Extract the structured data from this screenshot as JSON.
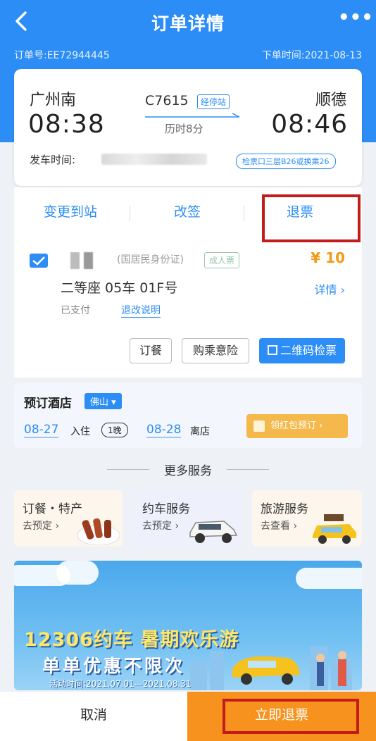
{
  "header": {
    "title": "订单详情",
    "back_icon": "back-arrow-icon",
    "more_icon": "more-dots-icon",
    "more_label": "•••"
  },
  "order": {
    "number": "订单号:EE72944445",
    "placed_time": "下单时间:2021-08-13"
  },
  "trip": {
    "from_station": "广州南",
    "to_station": "顺德",
    "depart_time": "08:38",
    "arrive_time": "08:46",
    "train_no": "C7615",
    "stop_tag": "经停站",
    "duration": "历时8分",
    "depart_label": "发车时间:",
    "gate_info": "检票口三层B26或换乘26"
  },
  "actions": {
    "change_station": "变更到站",
    "reschedule": "改签",
    "refund": "退票"
  },
  "passenger": {
    "id_type": "(国居民身份证)",
    "ticket_type": "成人票",
    "price": "¥ 10",
    "seat": "二等座 05车 01F号",
    "detail": "详情 ›",
    "status": "已支付",
    "rule_link": "退改说明",
    "btn_meal": "订餐",
    "btn_insurance": "购乘意险",
    "btn_qr": "二维码检票"
  },
  "hotel": {
    "title": "预订酒店",
    "city": "佛山 ▾",
    "checkin_date": "08-27",
    "checkin_label": "入住",
    "nights": "1晚",
    "checkout_date": "08-28",
    "checkout_label": "离店",
    "cta": "领红包预订 ›"
  },
  "services": {
    "title": "更多服务",
    "items": [
      {
        "title": "订餐・特产",
        "sub": "去预定 ›"
      },
      {
        "title": "约车服务",
        "sub": "去预定 ›"
      },
      {
        "title": "旅游服务",
        "sub": "去查看 ›"
      }
    ]
  },
  "banner": {
    "line1": "12306约车 暑期欢乐游",
    "line2": "单单优惠不限次",
    "line3": "活动时间:2021.07.01—2021.08.31"
  },
  "bottom": {
    "cancel": "取消",
    "confirm": "立即退票"
  },
  "colors": {
    "primary": "#2b8df5",
    "accent_orange": "#f7921e",
    "price": "#f39a16",
    "highlight_box": "#c41b1b"
  }
}
